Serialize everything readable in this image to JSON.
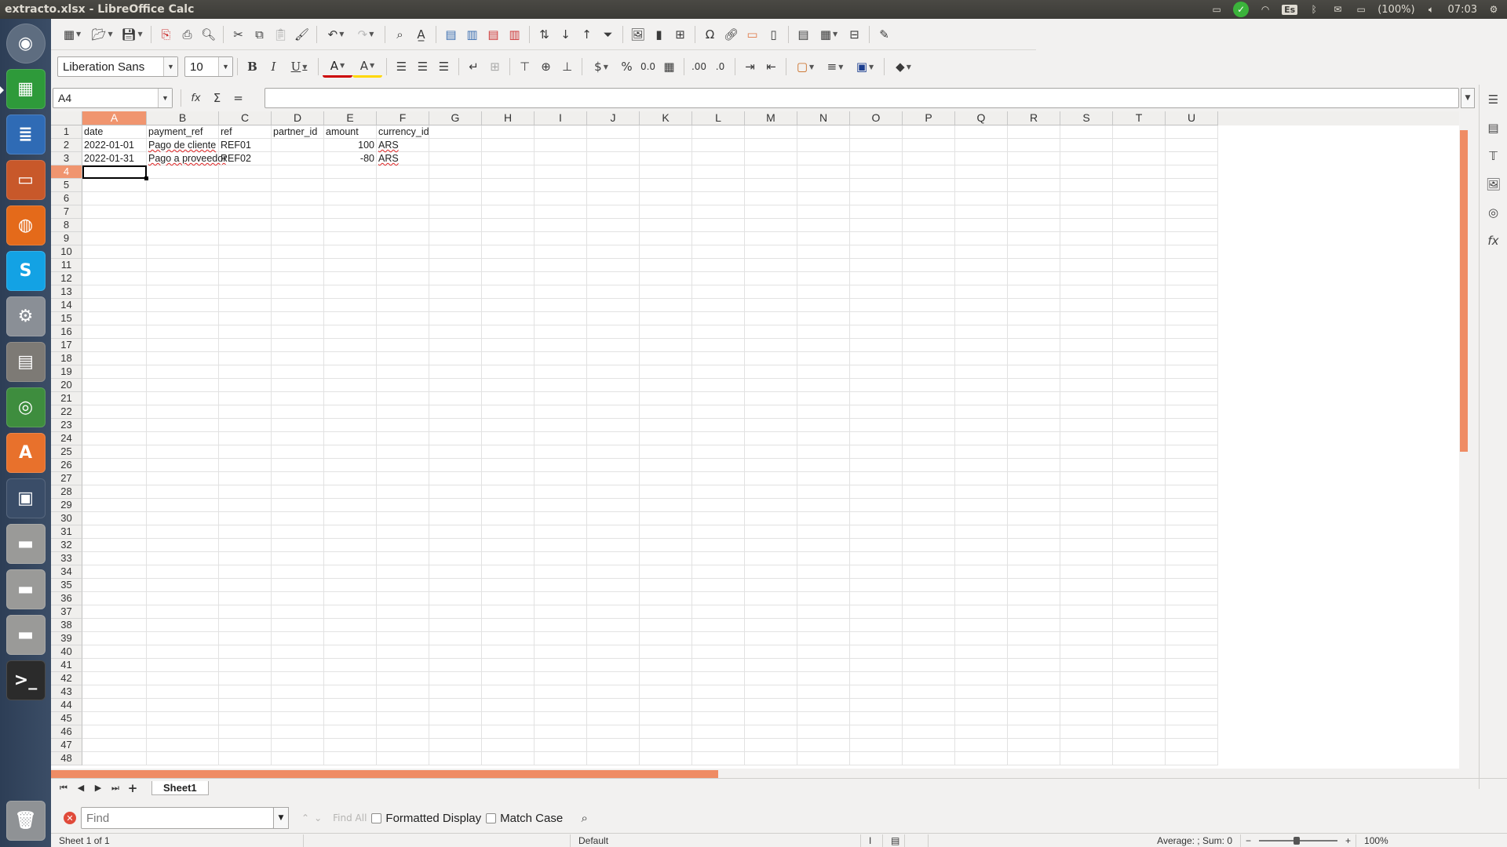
{
  "window": {
    "title": "extracto.xlsx - LibreOffice Calc"
  },
  "tray": {
    "keyboard": "Es",
    "battery": "(100%)",
    "clock": "07:03"
  },
  "launcher": [
    {
      "name": "dash-home-icon",
      "glyph": "◉",
      "color": "#5e6d80"
    },
    {
      "name": "calc-launcher-icon",
      "glyph": "▦",
      "color": "#2e9a3a"
    },
    {
      "name": "writer-launcher-icon",
      "glyph": "≣",
      "color": "#2f6bb5"
    },
    {
      "name": "impress-launcher-icon",
      "glyph": "▭",
      "color": "#c8582a"
    },
    {
      "name": "firefox-launcher-icon",
      "glyph": "◍",
      "color": "#e46a1a"
    },
    {
      "name": "skype-launcher-icon",
      "glyph": "S",
      "color": "#13a2e4"
    },
    {
      "name": "system-settings-launcher-icon",
      "glyph": "⚙",
      "color": "#8a8f96"
    },
    {
      "name": "files-launcher-icon",
      "glyph": "▤",
      "color": "#7d7a75"
    },
    {
      "name": "chrome-launcher-icon",
      "glyph": "◎",
      "color": "#3e8d3e"
    },
    {
      "name": "software-center-launcher-icon",
      "glyph": "A",
      "color": "#e8712c"
    },
    {
      "name": "workspace-switcher-launcher-icon",
      "glyph": "▣",
      "color": "#3a4d68"
    },
    {
      "name": "drive-launcher-icon-1",
      "glyph": "▬",
      "color": "#9a9a98"
    },
    {
      "name": "drive-launcher-icon-2",
      "glyph": "▬",
      "color": "#9a9a98"
    },
    {
      "name": "drive-launcher-icon-3",
      "glyph": "▬",
      "color": "#9a9a98"
    },
    {
      "name": "terminal-launcher-icon",
      "glyph": ">_",
      "color": "#2b2b2b"
    }
  ],
  "font": {
    "name": "Liberation Sans",
    "size": "10"
  },
  "namebox": "A4",
  "formula_symbols": {
    "function_wizard": "fx",
    "sum": "Σ",
    "equals": "="
  },
  "columns": [
    "A",
    "B",
    "C",
    "D",
    "E",
    "F",
    "G",
    "H",
    "I",
    "J",
    "K",
    "L",
    "M",
    "N",
    "O",
    "P",
    "Q",
    "R",
    "S",
    "T",
    "U"
  ],
  "selected": {
    "column": "A",
    "row": 4
  },
  "cells": [
    {
      "row": 1,
      "values": [
        "date",
        "payment_ref",
        "ref",
        "partner_id",
        "amount",
        "currency_id"
      ]
    },
    {
      "row": 2,
      "values": [
        "2022-01-01",
        "Pago de cliente",
        "REF01",
        "",
        "100",
        "ARS"
      ]
    },
    {
      "row": 3,
      "values": [
        "2022-01-31",
        "Pago a proveedor",
        "REF02",
        "",
        "-80",
        "ARS"
      ]
    }
  ],
  "sheet_tabs": [
    "Sheet1"
  ],
  "findbar": {
    "placeholder": "Find",
    "find_all": "Find All",
    "formatted_display": "Formatted Display",
    "match_case": "Match Case"
  },
  "status": {
    "sheet": "Sheet 1 of 1",
    "page_style": "Default",
    "aggregate": "Average: ; Sum: 0",
    "zoom": "100%"
  },
  "colors": {
    "accent": "#ef8c64",
    "header_selected": "#f0956f"
  }
}
